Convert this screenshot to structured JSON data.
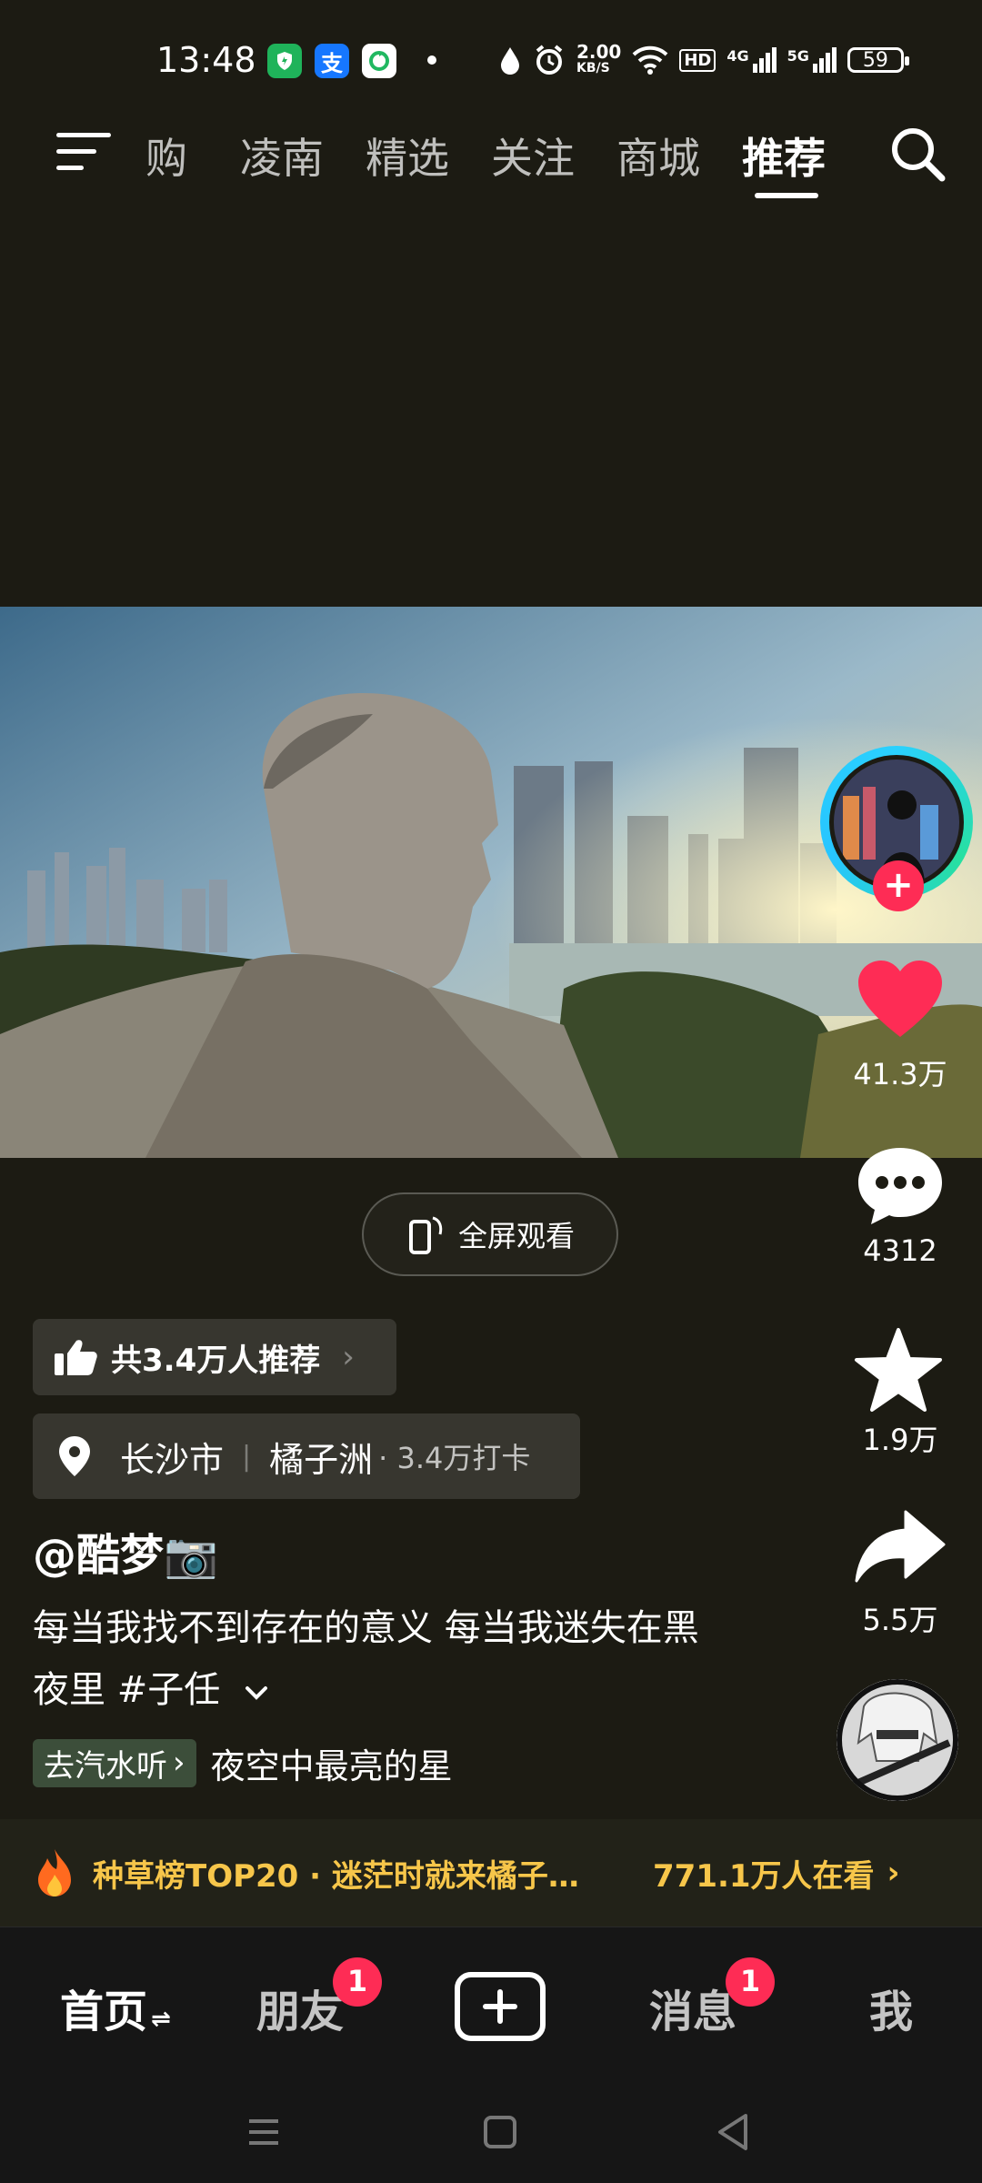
{
  "status_bar": {
    "time": "13:48",
    "net_speed_value": "2.00",
    "net_speed_unit": "KB/S",
    "hd_label": "HD",
    "signal1_label": "4G",
    "signal2_label": "5G",
    "battery": "59",
    "app_icons": [
      "shield-app-icon",
      "alipay-icon",
      "refresh-app-icon"
    ]
  },
  "top_nav": {
    "tabs": [
      "购",
      "凌南",
      "精选",
      "关注",
      "商城",
      "推荐"
    ],
    "active_tab": "推荐"
  },
  "video": {
    "fullscreen_label": "全屏观看"
  },
  "right_rail": {
    "likes": "41.3万",
    "comments": "4312",
    "favorites": "1.9万",
    "shares": "5.5万",
    "follow_symbol": "+"
  },
  "info": {
    "recommend_label": "共3.4万人推荐",
    "location_city": "长沙市",
    "location_place": "橘子洲",
    "location_checkins": "· 3.4万打卡",
    "username": "@酷梦📷",
    "caption": "每当我找不到存在的意义 每当我迷失在黑夜里 #子任",
    "music_tag": "去汽水听",
    "music_title": "夜空中最亮的星"
  },
  "hot_banner": {
    "title": "种草榜TOP20 · 迷茫时就来橘子…",
    "viewers": "771.1万人在看"
  },
  "bottom_nav": {
    "home": "首页",
    "friends": "朋友",
    "friends_badge": "1",
    "messages": "消息",
    "messages_badge": "1",
    "me": "我"
  },
  "colors": {
    "background": "#1c1b13",
    "accent_red": "#fe2c55",
    "banner_gold": "#f7c64a"
  }
}
